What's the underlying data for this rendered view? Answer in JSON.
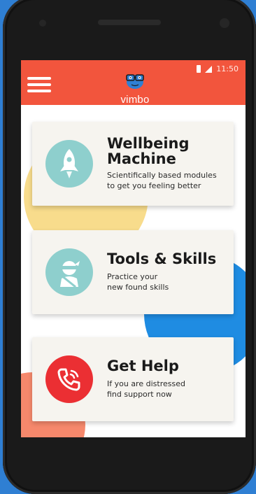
{
  "status_bar": {
    "time": "11:50"
  },
  "header": {
    "brand_name": "vimbo",
    "background_color": "#f2553d"
  },
  "menu": {
    "icon": "hamburger-menu-icon"
  },
  "cards": [
    {
      "title_line1": "Wellbeing",
      "title_line2": "Machine",
      "desc_line1": "Scientifically based modules",
      "desc_line2": "to get you feeling better",
      "icon": "rocket-icon",
      "icon_color": "#8ecfcd"
    },
    {
      "title_line1": "Tools & Skills",
      "desc_line1": "Practice your",
      "desc_line2": "new found skills",
      "icon": "ninja-icon",
      "icon_color": "#8ecfcd"
    },
    {
      "title_line1": "Get Help",
      "desc_line1": "If you are distressed",
      "desc_line2": "find support now",
      "icon": "phone-icon",
      "icon_color": "#eb2f33"
    }
  ],
  "colors": {
    "background": "#2f7fd3",
    "accent_yellow": "#f8dc8c",
    "accent_blue": "#1f8ce2",
    "accent_orange": "#f6886c"
  }
}
